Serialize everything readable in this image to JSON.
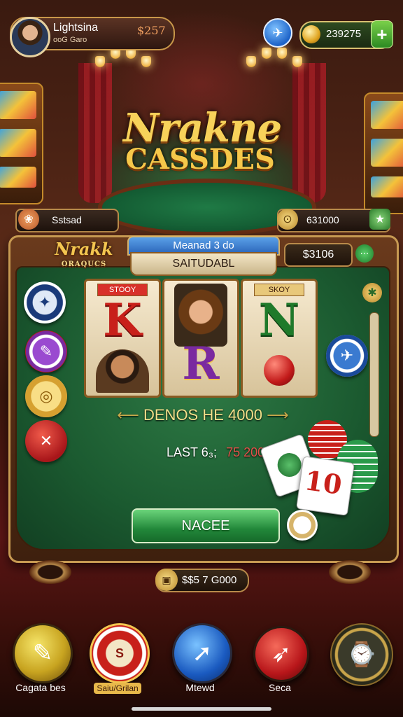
{
  "profile": {
    "name": "Lightsina",
    "subtitle": "ooG Garo",
    "value": "$257"
  },
  "header": {
    "coins": "239275",
    "plus_label": "+"
  },
  "game_title": {
    "line1": "Nrakne",
    "line2": "CASSDES"
  },
  "left_pill": {
    "label": "Sstsad"
  },
  "right_pill": {
    "label": "631000"
  },
  "panel": {
    "logo": "Nrakk",
    "logo_sub": "ORAQUCS",
    "tab_top": "Meanad 3 do",
    "tab_main": "SAITUDABL",
    "balance": "$3106",
    "menu_icon": "⋯"
  },
  "reels": [
    {
      "tag": "STOOY",
      "letter": "K",
      "color": "#c8201a"
    },
    {
      "tag": "",
      "letter": "R",
      "color": "#7a2aa0"
    },
    {
      "tag": "SKOY",
      "letter": "N",
      "color": "#1f7a2a"
    }
  ],
  "result": {
    "win_line": "DENOS HE 4000",
    "last_label": "LAST 6₃;",
    "last_value": "75 2005"
  },
  "spin_label": "NACEE",
  "card_value": "10",
  "bet": {
    "value": "$$5 7 G000"
  },
  "nav": [
    {
      "label": "Cagata bes",
      "icon": "pencil-icon"
    },
    {
      "label": "Saiu/Grilan",
      "icon": "chip-icon"
    },
    {
      "label": "Mtewd",
      "icon": "arrow-icon"
    },
    {
      "label": "Seca",
      "icon": "heart-arrow-icon"
    },
    {
      "label": "",
      "icon": "clock-icon"
    }
  ],
  "colors": {
    "gold": "#f3c650",
    "felt": "#1b5a30",
    "accent_blue": "#2a64b8",
    "accent_green": "#22883a"
  }
}
